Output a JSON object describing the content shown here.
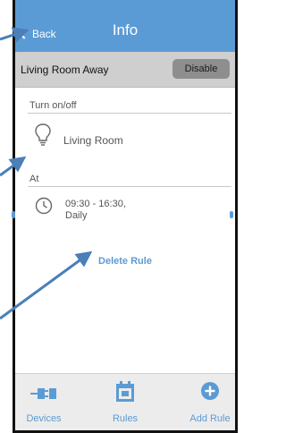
{
  "nav": {
    "back_label": "Back",
    "title": "Info"
  },
  "rule": {
    "name": "Living Room Away",
    "disable_label": "Disable"
  },
  "sections": {
    "turn_label": "Turn on/off",
    "device": "Living Room",
    "at_label": "At",
    "time": "09:30 - 16:30,",
    "repeat": "Daily"
  },
  "actions": {
    "delete_label": "Delete Rule"
  },
  "tabs": [
    {
      "label": "Devices",
      "icon": "plug-icon"
    },
    {
      "label": "Rules",
      "icon": "calendar-icon"
    },
    {
      "label": "Add Rule",
      "icon": "plus-circle-icon"
    }
  ],
  "colors": {
    "accent": "#5b9bd5",
    "annotation_arrow": "#4a7fb8",
    "rule_bar": "#cfcfcf"
  }
}
